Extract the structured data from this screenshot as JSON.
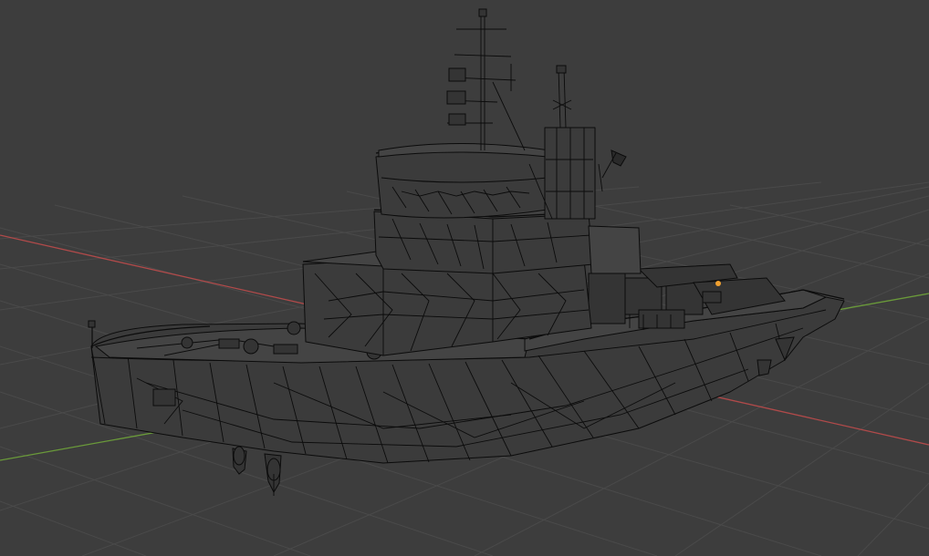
{
  "viewport": {
    "background": "#3d3d3d",
    "grid_color": "#4a4a4a",
    "x_axis_color": "#b04a4a",
    "y_axis_color": "#6a9a3a",
    "selection_origin_color": "#f0a030",
    "shading_mode": "wireframe"
  },
  "scene": {
    "object": "ship-tug-model",
    "icons": [
      "flag-icon",
      "object-origin-icon"
    ]
  }
}
